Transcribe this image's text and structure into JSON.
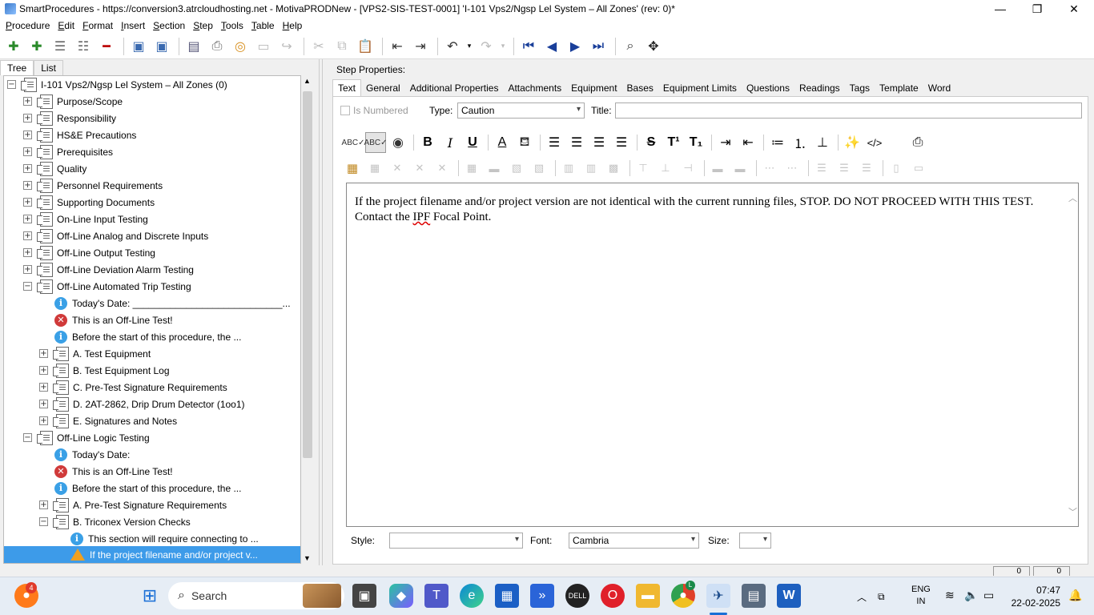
{
  "window": {
    "title": "SmartProcedures - https://conversion3.atrcloudhosting.net - MotivaPRODNew - [VPS2-SIS-TEST-0001] 'I-101 Vps2/Ngsp Lel System – All Zones' (rev: 0)*",
    "minimize": "—",
    "maximize": "❐",
    "close": "✕"
  },
  "menu": [
    {
      "first": "P",
      "rest": "rocedure"
    },
    {
      "first": "E",
      "rest": "dit"
    },
    {
      "first": "F",
      "rest": "ormat"
    },
    {
      "first": "I",
      "rest": "nsert"
    },
    {
      "first": "S",
      "rest": "ection"
    },
    {
      "first": "S",
      "rest": "tep"
    },
    {
      "first": "T",
      "rest": "ools"
    },
    {
      "first": "T",
      "rest": "able"
    },
    {
      "first": "H",
      "rest": "elp"
    }
  ],
  "left_tabs": {
    "tree": "Tree",
    "list": "List"
  },
  "tree": {
    "root": "I-101 Vps2/Ngsp Lel System – All Zones (0)",
    "sections": [
      "Purpose/Scope",
      "Responsibility",
      "HS&E Precautions",
      "Prerequisites",
      "Quality",
      "Personnel Requirements",
      "Supporting Documents",
      "On-Line Input Testing",
      "Off-Line Analog and Discrete Inputs",
      "Off-Line Output Testing",
      "Off-Line Deviation Alarm Testing"
    ],
    "trip": {
      "label": "Off-Line Automated Trip Testing",
      "steps": [
        "Today's Date: ____________________________...",
        "This is an Off-Line Test!",
        "Before the start of this procedure, the ..."
      ],
      "subs": [
        "A. Test Equipment",
        "B. Test Equipment Log",
        "C. Pre-Test Signature Requirements",
        "D. 2AT-2862, Drip Drum Detector (1oo1)",
        "E. Signatures and Notes"
      ]
    },
    "logic": {
      "label": "Off-Line Logic Testing",
      "steps": [
        "Today's Date:",
        "This is an Off-Line Test!",
        "Before the start of this procedure, the ..."
      ],
      "sub_a": "A. Pre-Test Signature Requirements",
      "sub_b": "B. Triconex Version Checks",
      "sub_b_steps": [
        "This section will require connecting to ...",
        "If the project filename and/or project v..."
      ]
    }
  },
  "step_properties": {
    "heading": "Step Properties:",
    "tabs": [
      "Text",
      "General",
      "Additional Properties",
      "Attachments",
      "Equipment",
      "Bases",
      "Equipment Limits",
      "Questions",
      "Readings",
      "Tags",
      "Template",
      "Word"
    ],
    "is_numbered": "Is Numbered",
    "type_label": "Type:",
    "type_value": "Caution",
    "title_label": "Title:",
    "text_before": "If the project filename and/or project version are not identical with the current running files, STOP. DO NOT PROCEED WITH THIS TEST. Contact the ",
    "text_spell": "IPF",
    "text_after": " Focal Point.",
    "style_label": "Style:",
    "font_label": "Font:",
    "font_value": "Cambria",
    "size_label": "Size:"
  },
  "statusbar": {
    "box1": "0",
    "box2": "0"
  },
  "taskbar": {
    "search": "Search",
    "lang1": "ENG",
    "lang2": "IN",
    "time": "07:47",
    "date": "22-02-2025",
    "badge": "4",
    "chrome_badge": "L"
  }
}
